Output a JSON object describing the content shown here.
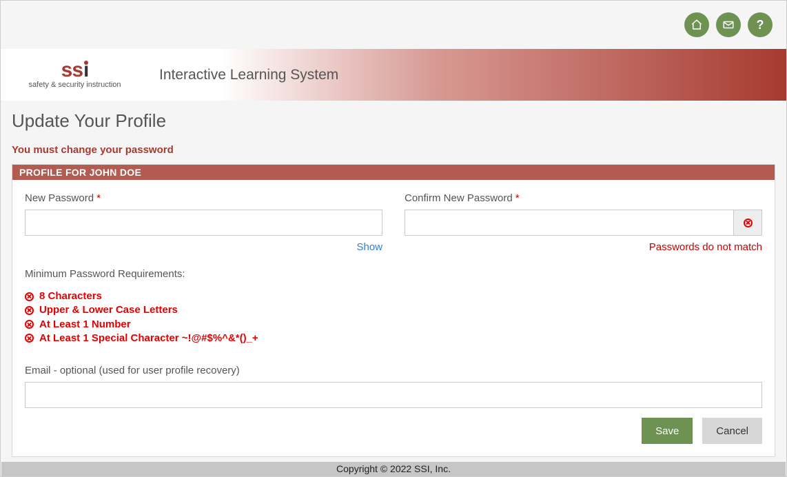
{
  "topbar": {
    "home": "home",
    "mail": "mail",
    "help": "?"
  },
  "logo": {
    "tagline": "safety & security instruction"
  },
  "banner": {
    "title": "Interactive Learning System"
  },
  "page": {
    "title": "Update Your Profile",
    "alert": "You must change your password"
  },
  "panel": {
    "header": "PROFILE FOR JOHN DOE"
  },
  "fields": {
    "new_password_label": "New Password",
    "confirm_password_label": "Confirm New Password",
    "required": "*",
    "show_link": "Show",
    "no_match": "Passwords do not match",
    "new_password_value": "",
    "confirm_password_value": ""
  },
  "requirements": {
    "title": "Minimum Password Requirements:",
    "items": [
      "8 Characters",
      "Upper & Lower Case Letters",
      "At Least 1 Number",
      "At Least 1 Special Character ~!@#$%^&*()_+"
    ]
  },
  "email": {
    "label": "Email - optional (used for user profile recovery)",
    "value": ""
  },
  "buttons": {
    "save": "Save",
    "cancel": "Cancel"
  },
  "footer": "Copyright © 2022 SSI, Inc."
}
